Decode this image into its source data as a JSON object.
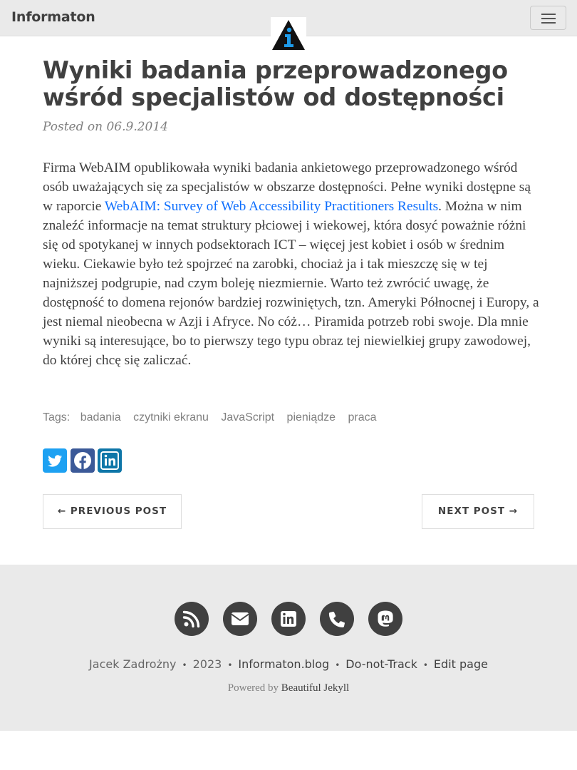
{
  "navbar": {
    "brand": "Informaton",
    "avatar_icon": "information-logo-icon",
    "menu_icon": "hamburger-menu-icon"
  },
  "post": {
    "title_line1": "Wyniki badania przeprowadzonego",
    "title_line2": "wśród specjalistów od dostępności",
    "meta": "Posted on 06.9.2014",
    "body_before_link": "Firma WebAIM opublikowała wyniki badania ankietowego przeprowadzonego wśród osób uważających się za specjalistów w obszarze dostępności. Pełne wyniki dostępne są w raporcie ",
    "link_text": "WebAIM: Survey of Web Accessibility Practitioners Results",
    "body_after_link": ". Można w nim znaleźć informacje na temat struktury płciowej i wiekowej, która dosyć poważnie różni się od spotykanej w innych podsektorach ICT – więcej jest kobiet i osób w średnim wieku. Ciekawie było też spojrzeć na zarobki, chociaż ja i tak mieszczę się w tej najniższej podgrupie, nad czym boleję niezmiernie. Warto też zwrócić uwagę, że dostępność to domena rejonów bardziej rozwiniętych, tzn. Ameryki Północnej i Europy, a jest niemal nieobecna w Azji i Afryce. No cóż… Piramida potrzeb robi swoje. Dla mnie wyniki są interesujące, bo to pierwszy tego typu obraz tej niewielkiej grupy zawodowej, do której chcę się zaliczać."
  },
  "tags": {
    "label": "Tags:",
    "items": [
      "badania",
      "czytniki ekranu",
      "JavaScript",
      "pieniądze",
      "praca"
    ]
  },
  "share": {
    "icons": [
      "twitter-icon",
      "facebook-icon",
      "linkedin-icon"
    ],
    "colors": {
      "twitter": "#1da1f2",
      "facebook": "#3b5998",
      "linkedin": "#0e76a8"
    }
  },
  "pager": {
    "previous": "← PREVIOUS POST",
    "next": "NEXT POST →"
  },
  "footer": {
    "icons": [
      "rss-icon",
      "envelope-icon",
      "linkedin-icon",
      "phone-icon",
      "mastodon-icon"
    ],
    "author": "Jacek Zadrożny",
    "year": "2023",
    "site": "Informaton.blog",
    "dnt": "Do-not-Track",
    "edit": "Edit page",
    "powered_prefix": "Powered by",
    "powered_link": "Beautiful Jekyll"
  }
}
